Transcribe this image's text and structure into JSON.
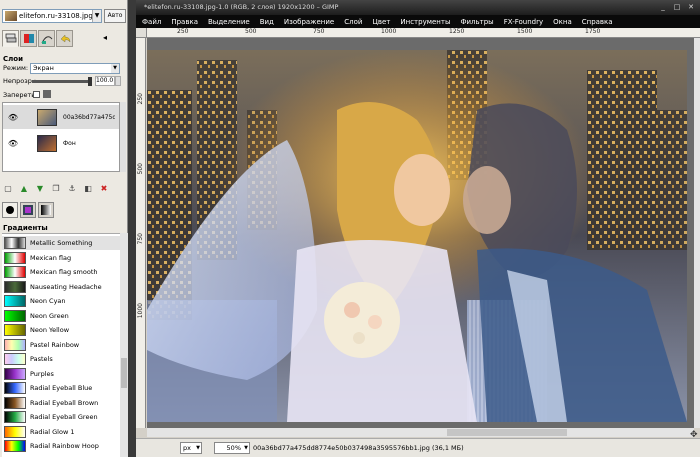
{
  "dock": {
    "image_name": "elitefon.ru-33108.jpg-1",
    "auto_label": "Авто",
    "close_glyph": "×",
    "layers": {
      "title": "Слои",
      "mode_label": "Режим:",
      "mode_value": "Экран",
      "opacity_label": "Непрозр.:",
      "opacity_value": "100.0",
      "opacity_fraction": 1.0,
      "lock_label": "Запереть:",
      "items": [
        {
          "name": "00a36bd77a475dd8",
          "visible": true
        },
        {
          "name": "Фон",
          "visible": true
        }
      ]
    },
    "gradients": {
      "title": "Градиенты",
      "items": [
        {
          "name": "Metallic Something",
          "colors": [
            "#555555",
            "#ffffff",
            "#333333",
            "#dddddd"
          ]
        },
        {
          "name": "Mexican flag",
          "colors": [
            "#00a000",
            "#ffffff",
            "#e00000"
          ]
        },
        {
          "name": "Mexican flag smooth",
          "colors": [
            "#00a000",
            "#ffffff",
            "#e00000"
          ]
        },
        {
          "name": "Nauseating Headache",
          "colors": [
            "#2a2a2a",
            "#4a6a3a",
            "#1a1a1a"
          ]
        },
        {
          "name": "Neon Cyan",
          "colors": [
            "#00ffff",
            "#006666"
          ]
        },
        {
          "name": "Neon Green",
          "colors": [
            "#00ff00",
            "#006600"
          ]
        },
        {
          "name": "Neon Yellow",
          "colors": [
            "#ffff00",
            "#666600"
          ]
        },
        {
          "name": "Pastel Rainbow",
          "colors": [
            "#ffb0b0",
            "#ffffb0",
            "#b0ffb0",
            "#b0b0ff"
          ]
        },
        {
          "name": "Pastels",
          "colors": [
            "#ffccee",
            "#ccccff",
            "#ccffee",
            "#ffffcc"
          ]
        },
        {
          "name": "Purples",
          "colors": [
            "#330044",
            "#9933cc",
            "#ccaaff"
          ]
        },
        {
          "name": "Radial Eyeball Blue",
          "colors": [
            "#000000",
            "#3366ff",
            "#ffffff"
          ]
        },
        {
          "name": "Radial Eyeball Brown",
          "colors": [
            "#000000",
            "#885522",
            "#ffffff"
          ]
        },
        {
          "name": "Radial Eyeball Green",
          "colors": [
            "#000000",
            "#22aa44",
            "#ffffff"
          ]
        },
        {
          "name": "Radial Glow 1",
          "colors": [
            "#ff6600",
            "#ffff00",
            "#ffffff"
          ]
        },
        {
          "name": "Radial Rainbow Hoop",
          "colors": [
            "#ff0000",
            "#ffff00",
            "#00ff00",
            "#0000ff"
          ]
        }
      ]
    }
  },
  "window": {
    "title": "*elitefon.ru-33108.jpg-1.0 (RGB, 2 слоя) 1920x1200 – GIMP",
    "menu": [
      "Файл",
      "Правка",
      "Выделение",
      "Вид",
      "Изображение",
      "Слой",
      "Цвет",
      "Инструменты",
      "Фильтры",
      "FX-Foundry",
      "Окна",
      "Справка"
    ]
  },
  "rulers": {
    "h_ticks": [
      "250",
      "500",
      "750",
      "1000",
      "1250",
      "1500",
      "1750"
    ],
    "v_ticks": [
      "250",
      "500",
      "750",
      "1000"
    ]
  },
  "status": {
    "unit": "px",
    "zoom": "50%",
    "text": "00a36bd77a475dd8774e50b037498a3595576bb1.jpg (36,1 МБ)"
  }
}
